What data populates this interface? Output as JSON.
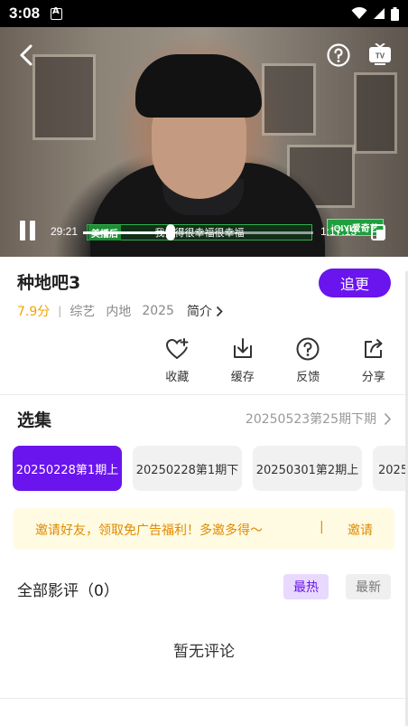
{
  "status_bar": {
    "time": "3:08"
  },
  "player": {
    "current_time": "29:21",
    "total_time": "1:17:15",
    "progress": 0.38,
    "subtitle": "我觉得很幸福很幸福",
    "sponsor_tag": "美播后",
    "watermark": "iQIYI爱奇艺"
  },
  "show": {
    "title": "种地吧3",
    "follow_label": "追更",
    "score": "7.9分",
    "separator": "|",
    "genre": "综艺",
    "region": "内地",
    "year": "2025",
    "intro_label": "简介"
  },
  "actions": [
    {
      "label": "收藏",
      "icon": "heart-plus-icon"
    },
    {
      "label": "缓存",
      "icon": "download-icon"
    },
    {
      "label": "反馈",
      "icon": "question-icon"
    },
    {
      "label": "分享",
      "icon": "share-icon"
    }
  ],
  "episodes": {
    "title": "选集",
    "current": "20250523第25期下期",
    "items": [
      {
        "label": "20250228第1期上",
        "active": true
      },
      {
        "label": "20250228第1期下",
        "active": false
      },
      {
        "label": "20250301第2期上",
        "active": false
      },
      {
        "label": "20250301第2期下",
        "active": false
      }
    ]
  },
  "invite": {
    "text": "邀请好友，领取免广告福利！多邀多得～",
    "separator": "|",
    "button": "邀请"
  },
  "reviews": {
    "title": "全部影评（0）",
    "sort_hot": "最热",
    "sort_new": "最新",
    "empty": "暂无评论"
  },
  "colors": {
    "accent": "#6a14ee",
    "score": "#f3a300",
    "invite_text": "#e08a00",
    "invite_bg": "#fffbe2"
  }
}
